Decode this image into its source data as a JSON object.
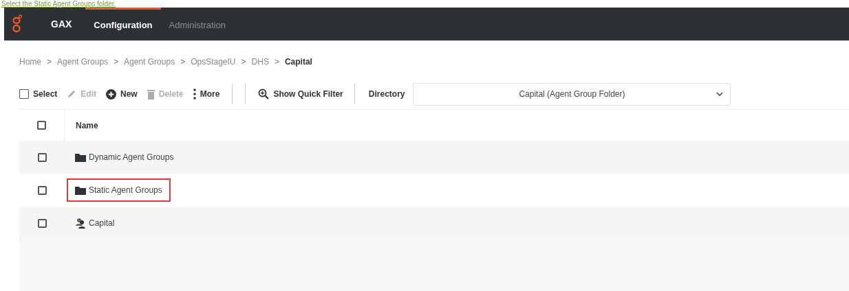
{
  "instruction": {
    "text": "Select the Static Agent Groups folder."
  },
  "navbar": {
    "brand": "GAX",
    "tabs": [
      {
        "label": "Configuration",
        "selected": true
      },
      {
        "label": "Administration",
        "selected": false
      }
    ]
  },
  "breadcrumb_separator": ">",
  "breadcrumb": [
    {
      "label": "Home",
      "current": false
    },
    {
      "label": "Agent Groups",
      "current": false
    },
    {
      "label": "Agent Groups",
      "current": false
    },
    {
      "label": "OpsStageIU",
      "current": false
    },
    {
      "label": "DHS",
      "current": false
    },
    {
      "label": "Capital",
      "current": true
    }
  ],
  "toolbar": {
    "items": [
      {
        "kind": "select",
        "label": "Select",
        "disabled": false
      },
      {
        "kind": "edit",
        "label": "Edit",
        "disabled": true
      },
      {
        "kind": "new",
        "label": "New",
        "disabled": false
      },
      {
        "kind": "delete",
        "label": "Delete",
        "disabled": true
      },
      {
        "kind": "more",
        "label": "More",
        "disabled": false
      },
      {
        "kind": "filter",
        "label": "Show Quick Filter",
        "disabled": false
      }
    ],
    "directory_label": "Directory",
    "directory_value": "Capital (Agent Group Folder)"
  },
  "table": {
    "columns": [
      "Name"
    ],
    "header_checked": false,
    "rows": [
      {
        "kind": "folder",
        "name": "Dynamic Agent Groups",
        "checked": false,
        "highlighted": false
      },
      {
        "kind": "folder",
        "name": "Static Agent Groups",
        "checked": false,
        "highlighted": true
      },
      {
        "kind": "agent-group",
        "name": "Capital",
        "checked": false,
        "highlighted": false
      }
    ]
  }
}
